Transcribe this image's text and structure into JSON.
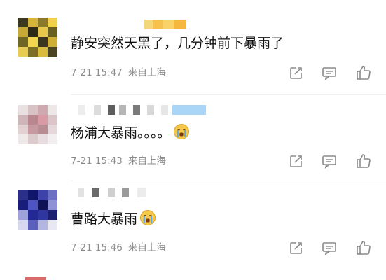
{
  "comments": [
    {
      "text": "静安突然天黑了，几分钟前下暴雨了",
      "time": "7-21 15:47",
      "location": "来自上海"
    },
    {
      "text": "杨浦大暴雨。。。。",
      "emoji": "crying-face-icon",
      "time": "7-21 15:43",
      "location": "来自上海"
    },
    {
      "text": "曹路大暴雨",
      "emoji": "crying-face-icon",
      "time": "7-21 15:46",
      "location": "来自上海"
    }
  ],
  "actions": [
    "share-icon",
    "comment-icon",
    "like-icon"
  ],
  "colors": {
    "text": "#111111",
    "meta": "#8c8c8c",
    "icon": "#8a8a8a",
    "emoji": "#f6c94a",
    "tears": "#5fa9e6"
  }
}
